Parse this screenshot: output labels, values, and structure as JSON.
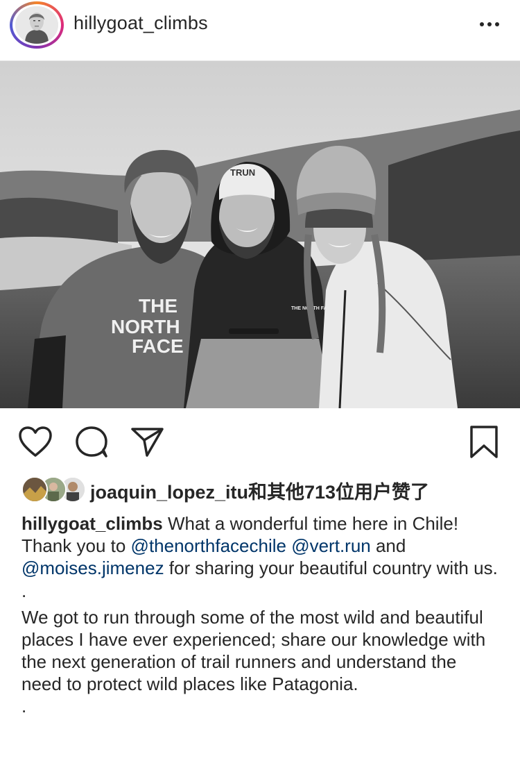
{
  "header": {
    "username": "hillygoat_climbs",
    "more_icon": "ellipsis-icon"
  },
  "photo": {
    "shirt_text_1": "THE",
    "shirt_text_2": "NORTH",
    "shirt_text_3": "FACE",
    "hoodie_text": "THE NORTH FACE",
    "hat_text": "TRUN"
  },
  "actions": {
    "like_icon": "heart-icon",
    "comment_icon": "comment-icon",
    "share_icon": "paper-plane-icon",
    "save_icon": "bookmark-icon"
  },
  "likes": {
    "text": "joaquin_lopez_itu和其他713位用户赞了"
  },
  "caption": {
    "username": "hillygoat_climbs",
    "text_1": " What a wonderful time here in Chile! Thank you to ",
    "mention_1": "@thenorthfacechile",
    "text_2": " ",
    "mention_2": "@vert.run",
    "text_3": " and ",
    "mention_3": "@moises.jimenez",
    "text_4": " for sharing your beautiful country with us.",
    "dot_1": ".",
    "paragraph_2": "We got to run through some of the most wild and beautiful places I have ever experienced; share our knowledge with the next generation of trail runners and understand the need to protect wild places like Patagonia.",
    "dot_2": "."
  },
  "colors": {
    "text": "#262626",
    "mention": "#003569",
    "divider": "#e6e6e6"
  }
}
